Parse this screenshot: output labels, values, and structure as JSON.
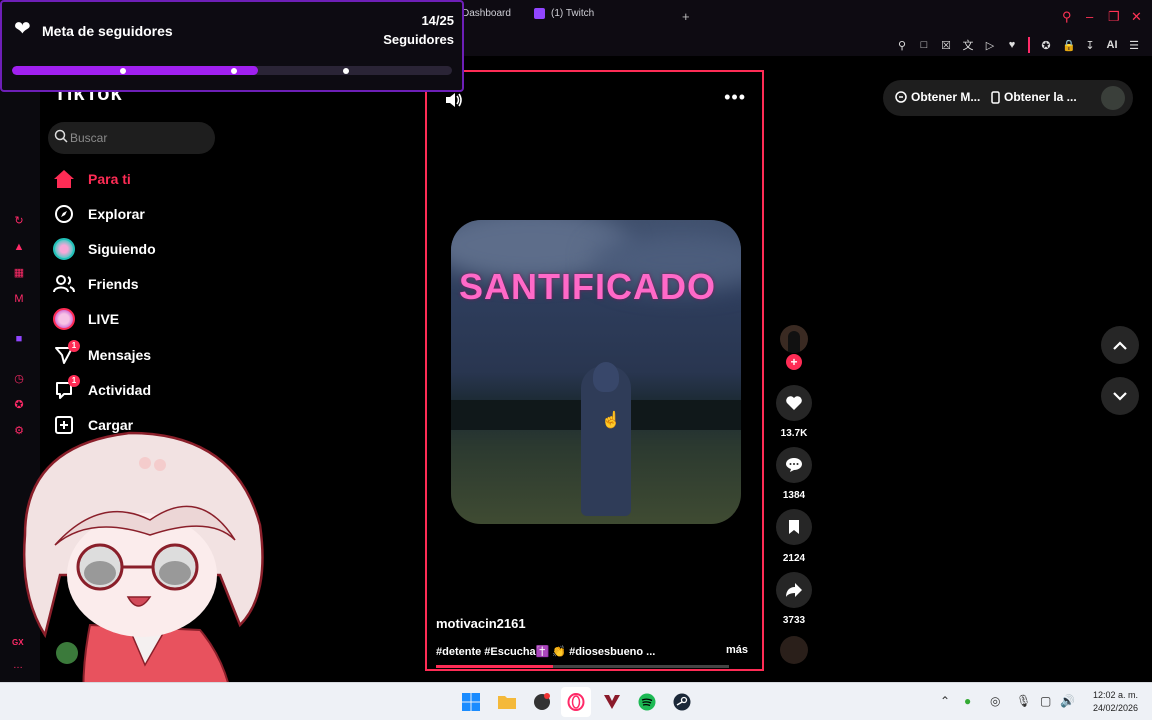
{
  "browser": {
    "tabs": [
      {
        "label": "Dashboard"
      },
      {
        "label": "(1) Twitch"
      }
    ],
    "new_tab": "+",
    "toolbar_ai": "AI"
  },
  "goal_overlay": {
    "title": "Meta de seguidores",
    "count": "14/25",
    "subtitle": "Seguidores",
    "progress_fraction": 0.56
  },
  "tiktok": {
    "logo": "TikTok",
    "search": {
      "placeholder": "Buscar",
      "value": ""
    },
    "nav": [
      {
        "label": "Para ti",
        "icon": "home-icon",
        "active": true
      },
      {
        "label": "Explorar",
        "icon": "compass-icon"
      },
      {
        "label": "Siguiendo",
        "icon": "following-avatar-icon"
      },
      {
        "label": "Friends",
        "icon": "friends-icon"
      },
      {
        "label": "LIVE",
        "icon": "live-icon"
      },
      {
        "label": "Mensajes",
        "icon": "send-icon",
        "badge": "1"
      },
      {
        "label": "Actividad",
        "icon": "activity-icon",
        "badge": "1"
      },
      {
        "label": "Cargar",
        "icon": "plus-square-icon"
      }
    ],
    "topright": {
      "btn1": "Obtener M...",
      "btn2": "Obtener la ..."
    }
  },
  "video": {
    "title_text": "SANTIFICADO",
    "author": "motivacin2161",
    "caption": "#detente #Escucha✝️ 👏 #diosesbueno ...",
    "more": "más",
    "progress_fraction": 0.4,
    "actions": {
      "likes": "13.7K",
      "comments": "1384",
      "saves": "2124",
      "shares": "3733"
    }
  },
  "taskbar": {
    "time": "12:02 a. m.",
    "date": "24/02/2026"
  },
  "colors": {
    "accent": "#fe2c55",
    "goal_purple": "#a020f0",
    "gx_red": "#ff2a68"
  }
}
